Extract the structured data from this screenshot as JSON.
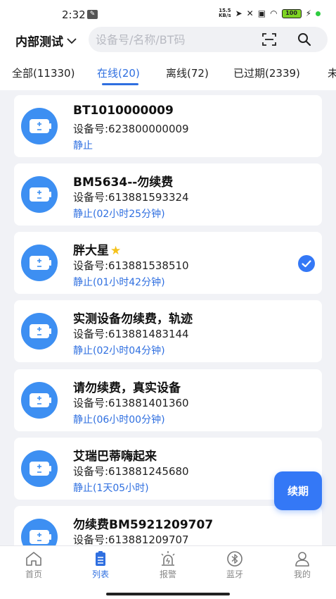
{
  "status_bar": {
    "time": "2:32",
    "net_speed_value": "15.5",
    "net_speed_unit": "KB/s",
    "battery": "100"
  },
  "header": {
    "group_label": "内部测试",
    "search_placeholder": "设备号/名称/BT码"
  },
  "tabs": [
    {
      "label": "全部(11330)"
    },
    {
      "label": "在线(20)"
    },
    {
      "label": "离线(72)"
    },
    {
      "label": "已过期(2339)"
    },
    {
      "label": "未"
    }
  ],
  "devices": [
    {
      "name": "BT1010000009",
      "id_label": "设备号:623800000009",
      "status": "静止"
    },
    {
      "name": "BM5634--勿续费",
      "id_label": "设备号:613881593324",
      "status": "静止(02小时25分钟)"
    },
    {
      "name": "胖大星",
      "id_label": "设备号:613881538510",
      "status": "静止(01小时42分钟)"
    },
    {
      "name": "实测设备勿续费，轨迹",
      "id_label": "设备号:613881483144",
      "status": "静止(02小时04分钟)"
    },
    {
      "name": "请勿续费，真实设备",
      "id_label": "设备号:613881401360",
      "status": "静止(06小时00分钟)"
    },
    {
      "name": "艾瑞巴蒂嗨起来",
      "id_label": "设备号:613881245680",
      "status": "静止(1天05小时)"
    },
    {
      "name": "勿续费BM5921209707",
      "id_label": "设备号:613881209707",
      "status": ""
    }
  ],
  "renew_button": "续期",
  "nav": [
    {
      "label": "首页",
      "icon": "home-icon"
    },
    {
      "label": "列表",
      "icon": "list-icon"
    },
    {
      "label": "报警",
      "icon": "alarm-icon"
    },
    {
      "label": "蓝牙",
      "icon": "bluetooth-icon"
    },
    {
      "label": "我的",
      "icon": "profile-icon"
    }
  ],
  "colors": {
    "accent": "#2f6fe0",
    "battery_icon": "#3d8ff2",
    "background": "#f1f2f6"
  }
}
